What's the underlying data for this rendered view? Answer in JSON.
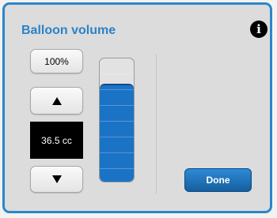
{
  "panel": {
    "title": "Balloon volume",
    "info_icon": "info-icon",
    "info_glyph": "i"
  },
  "controls": {
    "reset_label": "100%",
    "increase_icon": "triangle-up-icon",
    "decrease_icon": "triangle-down-icon",
    "volume_readout": "36.5 cc"
  },
  "gauge": {
    "fill_fraction": 0.78,
    "fill_color": "#1b73c6"
  },
  "actions": {
    "done_label": "Done"
  },
  "colors": {
    "accent": "#2a82c6",
    "panel_border": "#2d86c7",
    "done_button": "#1f74bb"
  }
}
